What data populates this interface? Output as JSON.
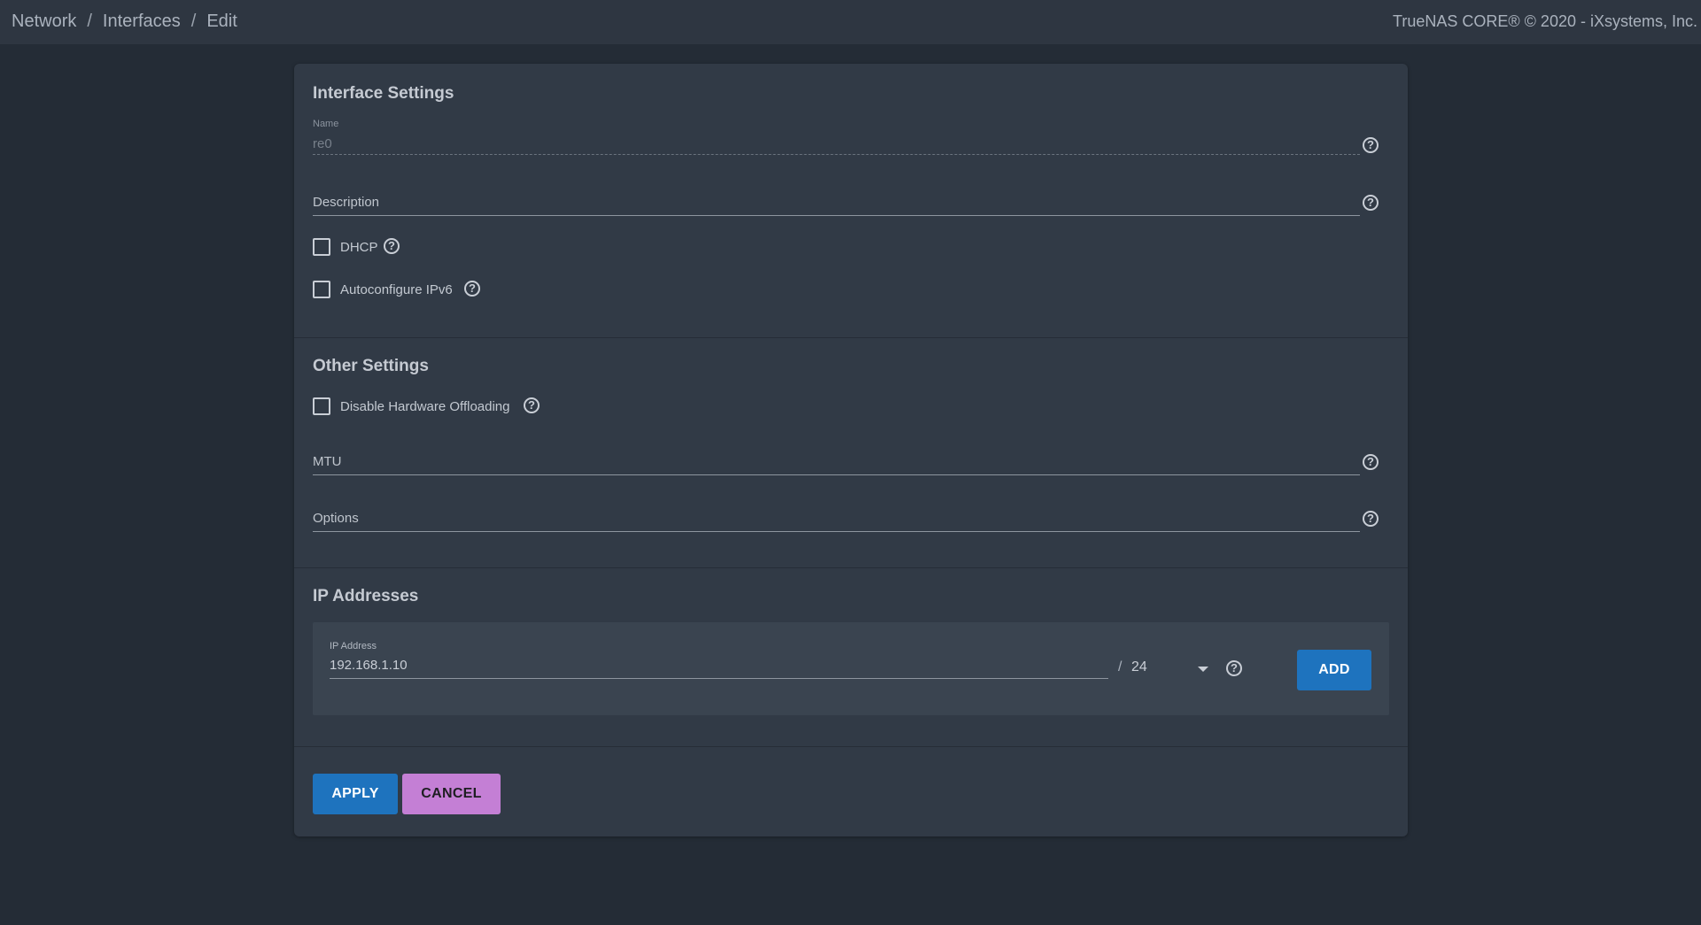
{
  "breadcrumb": {
    "items": [
      "Network",
      "Interfaces",
      "Edit"
    ],
    "separator": "/"
  },
  "footer_brand": "TrueNAS CORE® © 2020 - iXsystems, Inc.",
  "interface_settings": {
    "title": "Interface Settings",
    "name_field": {
      "label": "Name",
      "value": "re0",
      "disabled": true
    },
    "description_field": {
      "label": "Description",
      "value": ""
    },
    "dhcp": {
      "label": "DHCP",
      "checked": false
    },
    "autoconfigure_ipv6": {
      "label": "Autoconfigure IPv6",
      "checked": false
    }
  },
  "other_settings": {
    "title": "Other Settings",
    "disable_hw_offloading": {
      "label": "Disable Hardware Offloading",
      "checked": false
    },
    "mtu_field": {
      "label": "MTU",
      "value": ""
    },
    "options_field": {
      "label": "Options",
      "value": ""
    }
  },
  "ip_addresses": {
    "title": "IP Addresses",
    "ip_field": {
      "label": "IP Address",
      "value": "192.168.1.10"
    },
    "netmask_separator": "/",
    "netmask": "24",
    "add_label": "ADD"
  },
  "actions": {
    "apply_label": "APPLY",
    "cancel_label": "CANCEL"
  },
  "icons": {
    "help": "help-circle-icon",
    "dropdown": "caret-down-icon"
  },
  "help_glyph": "?",
  "colors": {
    "background": "#242c36",
    "topbar": "#2e3641",
    "card": "#313a46",
    "primary": "#1e73be",
    "accent": "#c47fd5"
  }
}
